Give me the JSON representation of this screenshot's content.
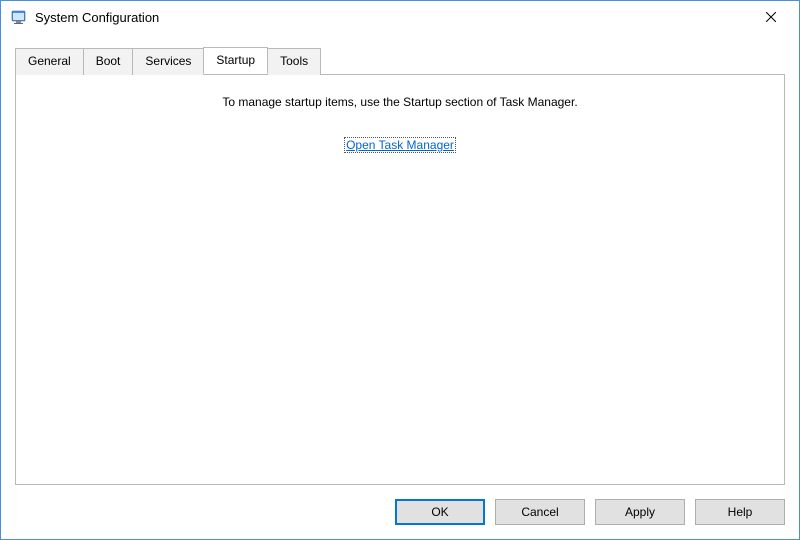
{
  "window": {
    "title": "System Configuration",
    "icon": "msconfig-icon"
  },
  "tabs": [
    {
      "label": "General",
      "active": false
    },
    {
      "label": "Boot",
      "active": false
    },
    {
      "label": "Services",
      "active": false
    },
    {
      "label": "Startup",
      "active": true
    },
    {
      "label": "Tools",
      "active": false
    }
  ],
  "panel": {
    "instruction": "To manage startup items, use the Startup section of Task Manager.",
    "link_label": "Open Task Manager"
  },
  "buttons": {
    "ok": "OK",
    "cancel": "Cancel",
    "apply": "Apply",
    "help": "Help"
  }
}
